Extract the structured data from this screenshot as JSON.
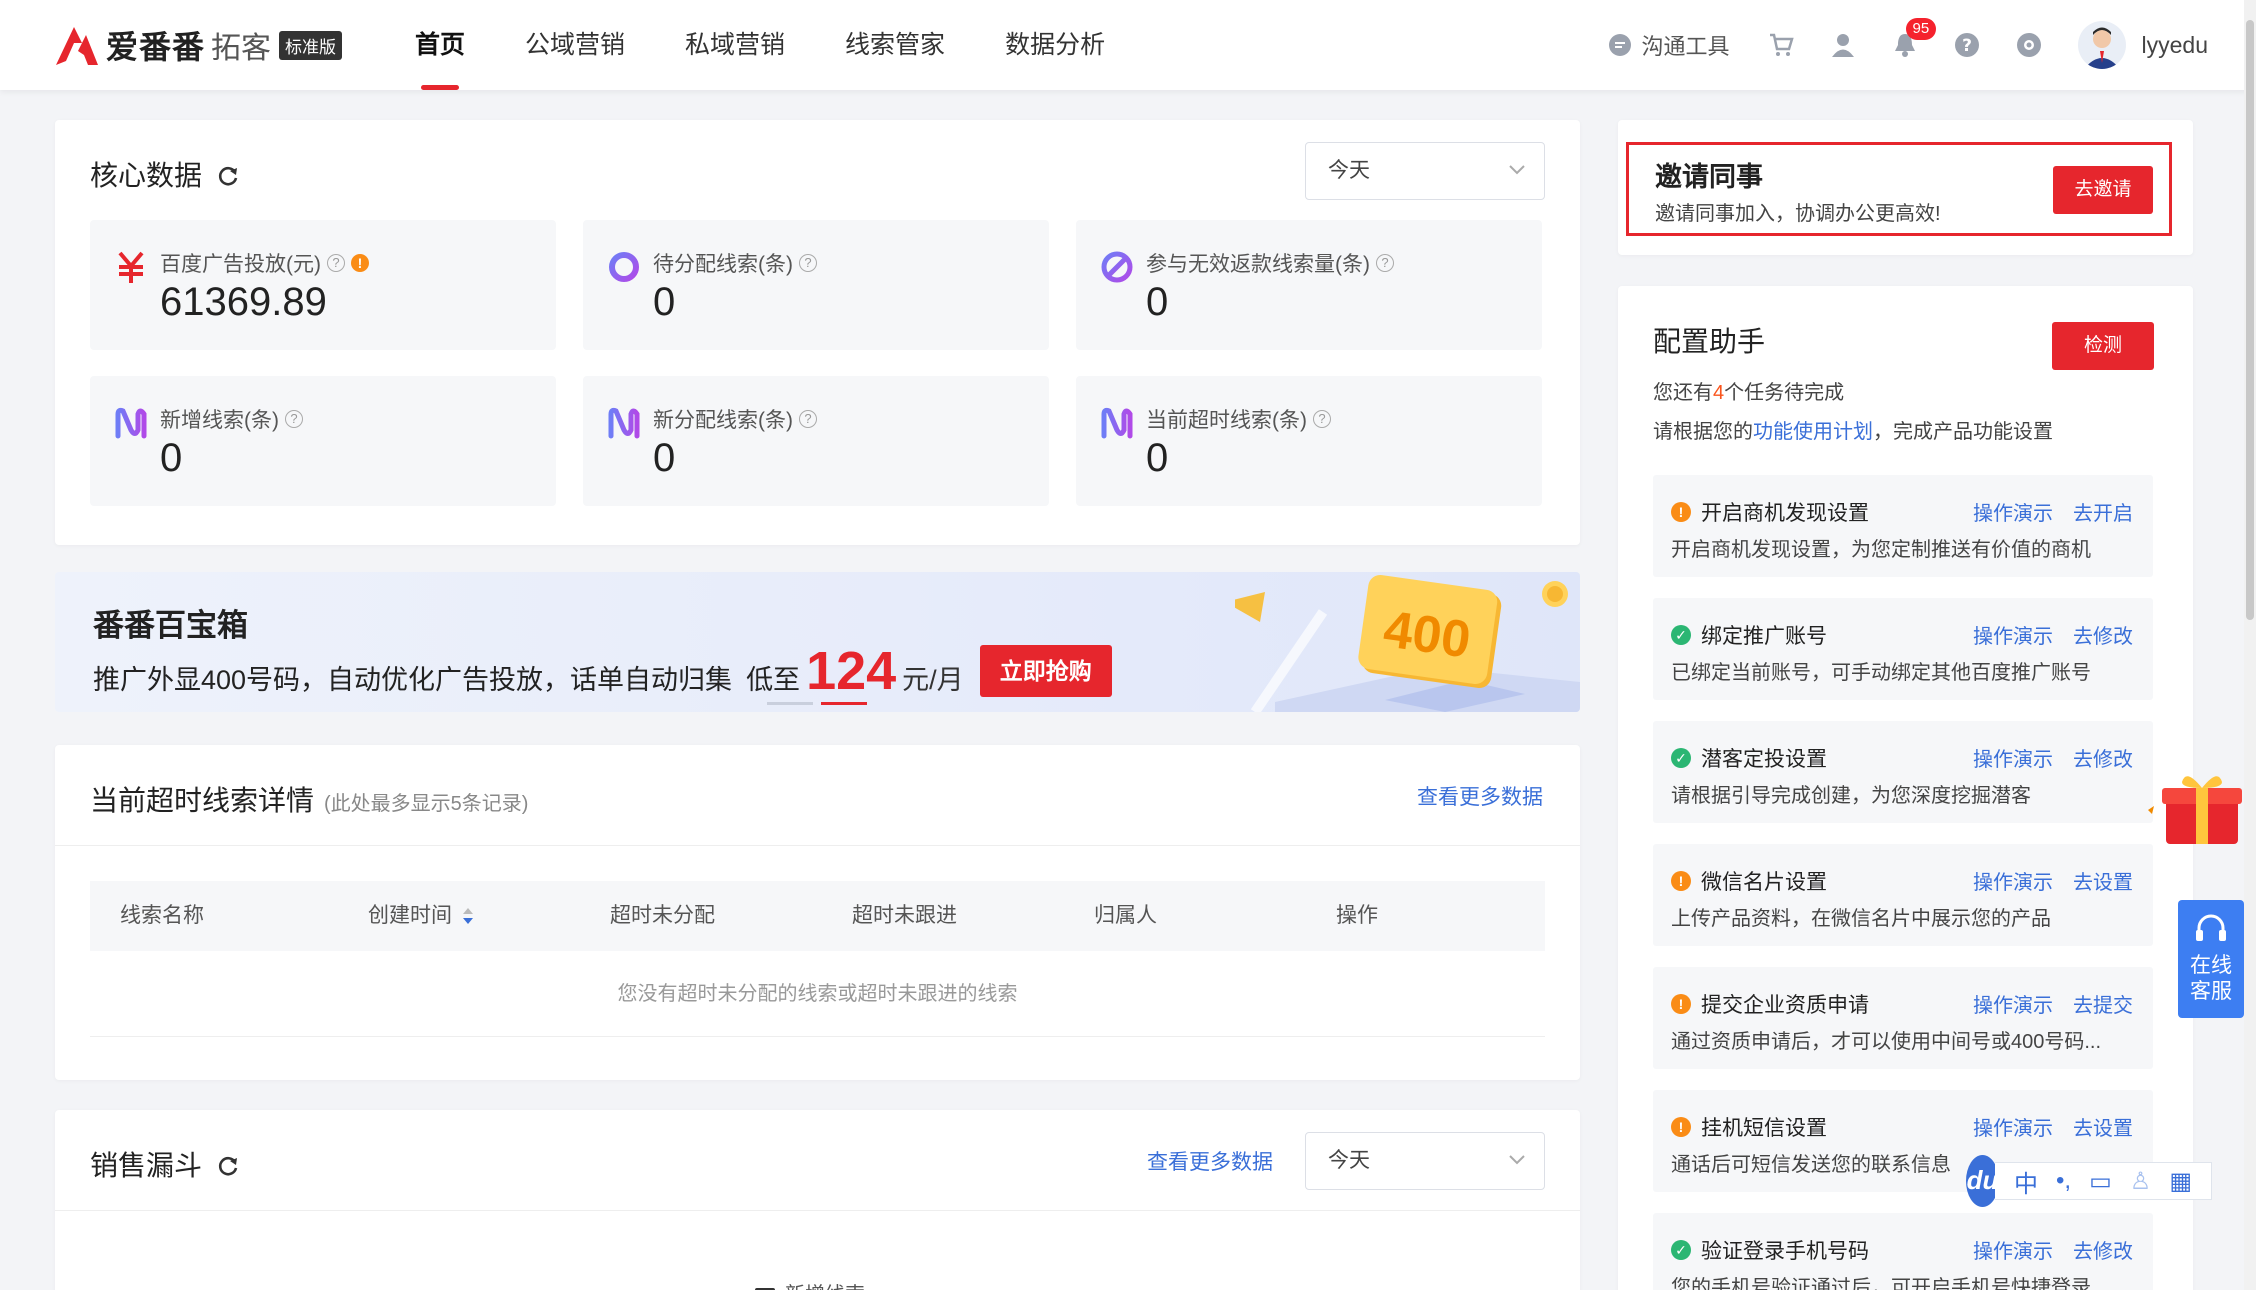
{
  "header": {
    "brand": "爱番番",
    "brand_sub": "拓客",
    "brand_badge": "标准版",
    "nav": [
      {
        "label": "首页",
        "active": true
      },
      {
        "label": "公域营销"
      },
      {
        "label": "私域营销"
      },
      {
        "label": "线索管家"
      },
      {
        "label": "数据分析"
      }
    ],
    "tool_label": "沟通工具",
    "notification_count": "95",
    "username": "lyyedu"
  },
  "core": {
    "title": "核心数据",
    "range": "今天",
    "metrics": [
      {
        "label": "百度广告投放(元)",
        "value": "61369.89",
        "icon": "yuan-icon"
      },
      {
        "label": "待分配线索(条)",
        "value": "0",
        "icon": "ring-icon"
      },
      {
        "label": "参与无效返款线索量(条)",
        "value": "0",
        "icon": "forbidden-icon"
      },
      {
        "label": "新增线索(条)",
        "value": "0",
        "icon": "wave-icon"
      },
      {
        "label": "新分配线索(条)",
        "value": "0",
        "icon": "wave-icon"
      },
      {
        "label": "当前超时线索(条)",
        "value": "0",
        "icon": "wave-icon"
      }
    ]
  },
  "banner": {
    "title": "番番百宝箱",
    "text": "推广外显400号码，自动优化广告投放，话单自动归集",
    "price_prefix": "低至",
    "price": "124",
    "price_unit": "元/月",
    "cta": "立即抢购",
    "art_number": "400"
  },
  "overdue": {
    "title": "当前超时线索详情",
    "subtitle": "(此处最多显示5条记录)",
    "more": "查看更多数据",
    "columns": [
      "线索名称",
      "创建时间",
      "超时未分配",
      "超时未跟进",
      "归属人",
      "操作"
    ],
    "empty": "您没有超时未分配的线索或超时未跟进的线索"
  },
  "funnel": {
    "title": "销售漏斗",
    "more": "查看更多数据",
    "range": "今天",
    "legend_partial": "新增线索"
  },
  "invite": {
    "title": "邀请同事",
    "subtitle": "邀请同事加入，协调办公更高效!",
    "button": "去邀请"
  },
  "assistant": {
    "title": "配置助手",
    "button": "检测",
    "remaining_prefix": "您还有",
    "remaining_count": "4",
    "remaining_suffix": "个任务待完成",
    "plan_prefix": "请根据您的",
    "plan_link": "功能使用计划",
    "plan_suffix": "，完成产品功能设置",
    "tasks": [
      {
        "name": "开启商机发现设置",
        "status": "warn",
        "demo": "操作演示",
        "action": "去开启",
        "desc": "开启商机发现设置，为您定制推送有价值的商机"
      },
      {
        "name": "绑定推广账号",
        "status": "ok",
        "demo": "操作演示",
        "action": "去修改",
        "desc": "已绑定当前账号，可手动绑定其他百度推广账号"
      },
      {
        "name": "潜客定投设置",
        "status": "ok",
        "demo": "操作演示",
        "action": "去修改",
        "desc": "请根据引导完成创建，为您深度挖掘潜客"
      },
      {
        "name": "微信名片设置",
        "status": "warn",
        "demo": "操作演示",
        "action": "去设置",
        "desc": "上传产品资料，在微信名片中展示您的产品"
      },
      {
        "name": "提交企业资质申请",
        "status": "warn",
        "demo": "操作演示",
        "action": "去提交",
        "desc": "通过资质申请后，才可以使用中间号或400号码..."
      },
      {
        "name": "挂机短信设置",
        "status": "warn",
        "demo": "操作演示",
        "action": "去设置",
        "desc": "通话后可短信发送您的联系信息"
      },
      {
        "name": "验证登录手机号码",
        "status": "ok",
        "demo": "操作演示",
        "action": "去修改",
        "desc": "您的手机号验证通过后，可开启手机号快捷登录"
      }
    ]
  },
  "support": {
    "label_line1": "在线",
    "label_line2": "客服"
  },
  "ime": {
    "brand": "du",
    "mode": "中"
  }
}
